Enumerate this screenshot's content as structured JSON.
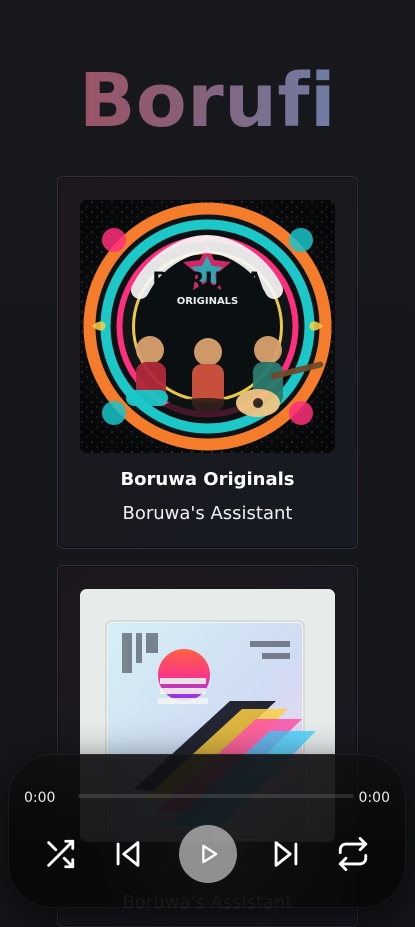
{
  "app": {
    "brand": "Borufi"
  },
  "cards": [
    {
      "title": "Boruwa Originals",
      "subtitle": "Boruwa's Assistant",
      "cover_text": {
        "top": "BORUWA",
        "ring": "ORIGINALS"
      }
    },
    {
      "title": "",
      "subtitle": "Boruwa's Assistant"
    }
  ],
  "player": {
    "current_time": "0:00",
    "duration": "0:00",
    "progress_fraction": 0
  },
  "icons": {
    "shuffle": "shuffle-icon",
    "previous": "skip-previous-icon",
    "play": "play-icon",
    "next": "skip-next-icon",
    "repeat": "repeat-icon"
  }
}
